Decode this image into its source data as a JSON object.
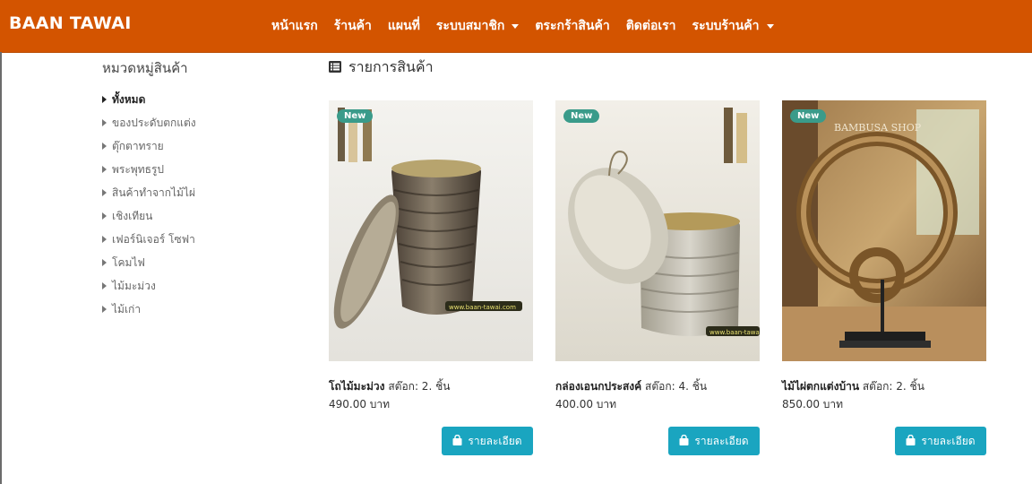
{
  "navbar": {
    "brand": "BAAN TAWAI",
    "links": [
      {
        "label": "หน้าแรก",
        "dropdown": false
      },
      {
        "label": "ร้านค้า",
        "dropdown": false
      },
      {
        "label": "แผนที่",
        "dropdown": false
      },
      {
        "label": "ระบบสมาชิก",
        "dropdown": true
      },
      {
        "label": "ตระกร้าสินค้า",
        "dropdown": false
      },
      {
        "label": "ติดต่อเรา",
        "dropdown": false
      },
      {
        "label": "ระบบร้านค้า",
        "dropdown": true
      }
    ],
    "color": "#d35400"
  },
  "sidebar": {
    "title": "หมวดหมู่สินค้า",
    "categories": [
      {
        "label": "ทั้งหมด",
        "active": true
      },
      {
        "label": "ของประดับตกแต่ง",
        "active": false
      },
      {
        "label": "ตุ๊กตาทราย",
        "active": false
      },
      {
        "label": "พระพุทธรูป",
        "active": false
      },
      {
        "label": "สินค้าทำจากไม้ไผ่",
        "active": false
      },
      {
        "label": "เชิงเทียน",
        "active": false
      },
      {
        "label": "เฟอร์นิเจอร์ โซฟา",
        "active": false
      },
      {
        "label": "โคมไฟ",
        "active": false
      },
      {
        "label": "ไม้มะม่วง",
        "active": false
      },
      {
        "label": "ไม้เก่า",
        "active": false
      }
    ]
  },
  "main": {
    "title": "รายการสินค้า",
    "title_icon": "list-icon",
    "products": [
      {
        "badge": "New",
        "name": "โถไม้มะม่วง",
        "stock": "สต๊อก: 2. ชิ้น",
        "price": "490.00 บาท",
        "button": "รายละเอียด",
        "watermark": "www.baan-tawai.com"
      },
      {
        "badge": "New",
        "name": "กล่องเอนกประสงค์",
        "stock": "สต๊อก: 4. ชิ้น",
        "price": "400.00 บาท",
        "button": "รายละเอียด",
        "watermark": "www.baan-tawai.com"
      },
      {
        "badge": "New",
        "name": "ไม้ไผ่ตกแต่งบ้าน",
        "stock": "สต๊อก: 2. ชิ้น",
        "price": "850.00 บาท",
        "button": "รายละเอียด",
        "watermark": "BAMBUSA SHOP"
      }
    ]
  },
  "colors": {
    "badge": "#3a9b8a",
    "button": "#1aa5c0"
  }
}
